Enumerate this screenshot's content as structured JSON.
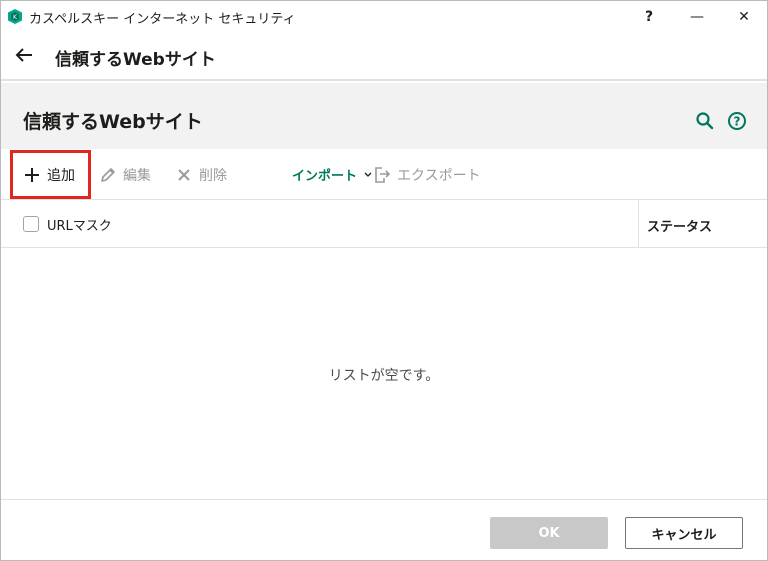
{
  "window": {
    "title": "カスペルスキー インターネット セキュリティ",
    "help_label": "?",
    "minimize_label": "—",
    "close_label": "✕"
  },
  "nav": {
    "back_icon": "arrow-left-icon",
    "title": "信頼するWebサイト"
  },
  "section": {
    "title": "信頼するWebサイト",
    "search_icon": "search-icon",
    "help_icon": "help-circle-icon"
  },
  "toolbar": {
    "add_label": "追加",
    "edit_label": "編集",
    "delete_label": "削除",
    "import_label": "インポート",
    "export_label": "エクスポート",
    "add_icon": "plus-icon",
    "edit_icon": "pencil-icon",
    "delete_icon": "x-icon",
    "import_icon": "chevron-down-icon",
    "export_icon": "export-icon"
  },
  "table": {
    "columns": [
      "URLマスク",
      "ステータス"
    ],
    "select_all_checked": false,
    "rows": [],
    "empty_message": "リストが空です。"
  },
  "footer": {
    "ok_label": "OK",
    "ok_enabled": false,
    "cancel_label": "キャンセル"
  },
  "colors": {
    "accent": "#00775d",
    "highlight": "#e0261d",
    "disabled_text": "#9a9a9a",
    "section_bg": "#f2f2f2"
  }
}
